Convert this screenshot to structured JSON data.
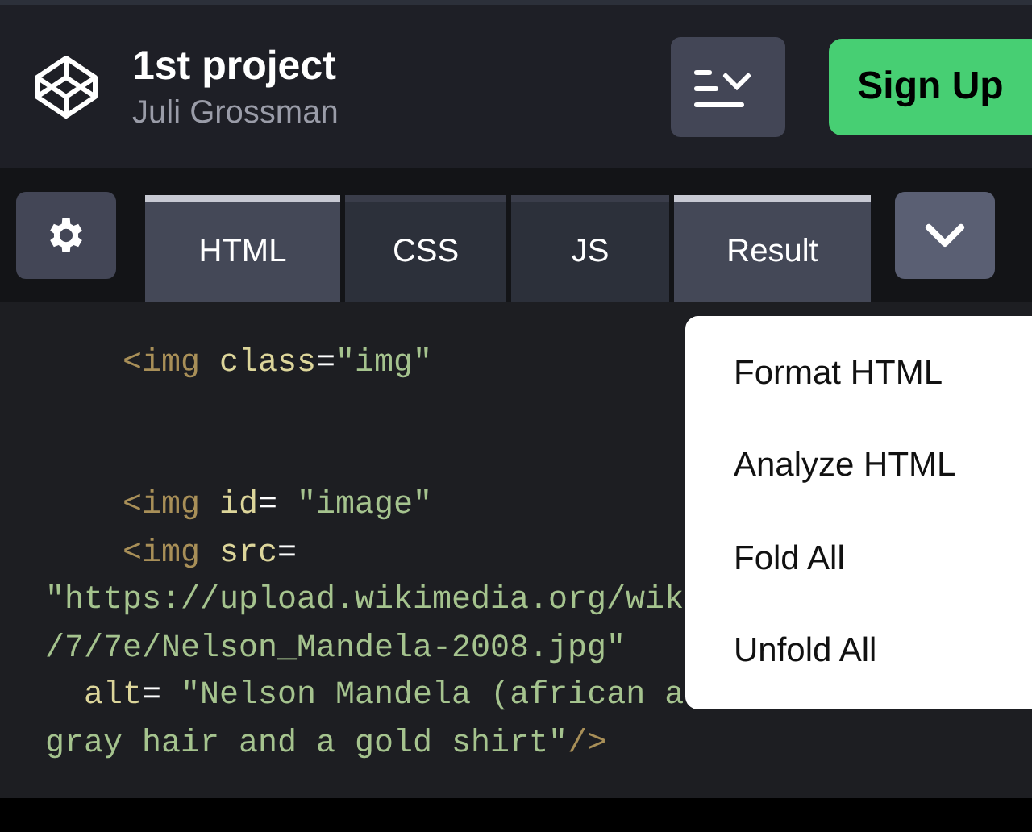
{
  "header": {
    "title": "1st project",
    "author": "Juli Grossman",
    "sign_up": "Sign Up"
  },
  "tabs": [
    {
      "label": "HTML",
      "selected": true
    },
    {
      "label": "CSS",
      "selected": false
    },
    {
      "label": "JS",
      "selected": false
    },
    {
      "label": "Result",
      "selected": true
    }
  ],
  "code_lines": [
    {
      "kind": "blank"
    },
    [
      {
        "kind": "tag",
        "text": "    <img"
      },
      {
        "kind": "attr",
        "text": " class"
      },
      {
        "kind": "punct",
        "text": "="
      },
      {
        "kind": "string",
        "text": "\"img\""
      }
    ],
    {
      "kind": "blank"
    },
    {
      "kind": "blank"
    },
    [
      {
        "kind": "tag",
        "text": "    <img"
      },
      {
        "kind": "attr",
        "text": " id"
      },
      {
        "kind": "punct",
        "text": "= "
      },
      {
        "kind": "string",
        "text": "\"image\""
      }
    ],
    [
      {
        "kind": "tag",
        "text": "    <img"
      },
      {
        "kind": "attr",
        "text": " src"
      },
      {
        "kind": "punct",
        "text": "="
      }
    ],
    [
      {
        "kind": "string",
        "text": "\"https://upload.wikimedia.org/wik"
      }
    ],
    [
      {
        "kind": "string",
        "text": "/7/7e/Nelson_Mandela-2008.jpg\""
      }
    ],
    [
      {
        "kind": "attr",
        "text": "  alt"
      },
      {
        "kind": "punct",
        "text": "= "
      },
      {
        "kind": "string",
        "text": "\"Nelson Mandela (african a"
      }
    ],
    [
      {
        "kind": "string",
        "text": "gray hair and a gold shirt\""
      },
      {
        "kind": "tag",
        "text": "/>"
      }
    ]
  ],
  "menu": [
    "Format HTML",
    "Analyze HTML",
    "Fold All",
    "Unfold All"
  ]
}
